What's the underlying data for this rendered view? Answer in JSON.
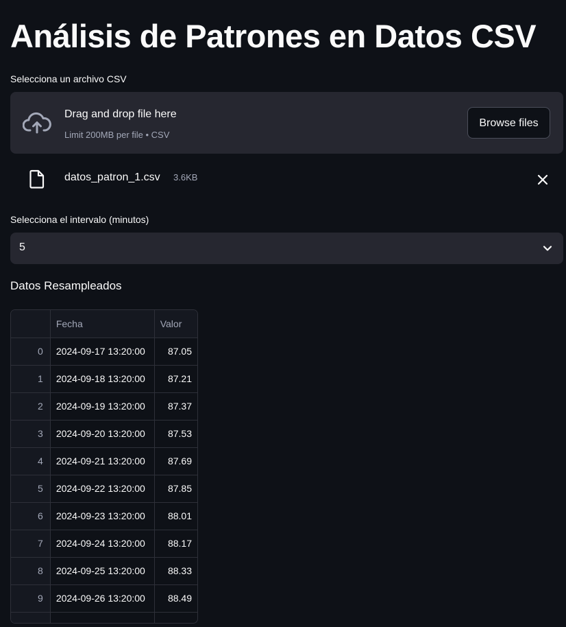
{
  "page": {
    "title": "Análisis de Patrones en Datos CSV"
  },
  "uploader": {
    "label": "Selecciona un archivo CSV",
    "drop_text": "Drag and drop file here",
    "limit_text": "Limit 200MB per file • CSV",
    "browse_label": "Browse files",
    "icon": "cloud-upload-icon"
  },
  "uploaded_file": {
    "name": "datos_patron_1.csv",
    "size": "3.6KB",
    "icon": "file-icon",
    "remove_icon": "close-icon"
  },
  "interval": {
    "label": "Selecciona el intervalo (minutos)",
    "value": "5"
  },
  "resampled": {
    "heading": "Datos Resampleados",
    "columns": [
      "",
      "Fecha",
      "Valor"
    ],
    "rows": [
      {
        "index": "0",
        "fecha": "2024-09-17 13:20:00",
        "valor": "87.05"
      },
      {
        "index": "1",
        "fecha": "2024-09-18 13:20:00",
        "valor": "87.21"
      },
      {
        "index": "2",
        "fecha": "2024-09-19 13:20:00",
        "valor": "87.37"
      },
      {
        "index": "3",
        "fecha": "2024-09-20 13:20:00",
        "valor": "87.53"
      },
      {
        "index": "4",
        "fecha": "2024-09-21 13:20:00",
        "valor": "87.69"
      },
      {
        "index": "5",
        "fecha": "2024-09-22 13:20:00",
        "valor": "87.85"
      },
      {
        "index": "6",
        "fecha": "2024-09-23 13:20:00",
        "valor": "88.01"
      },
      {
        "index": "7",
        "fecha": "2024-09-24 13:20:00",
        "valor": "88.17"
      },
      {
        "index": "8",
        "fecha": "2024-09-25 13:20:00",
        "valor": "88.33"
      },
      {
        "index": "9",
        "fecha": "2024-09-26 13:20:00",
        "valor": "88.49"
      },
      {
        "index": "",
        "fecha": "",
        "valor": ""
      }
    ]
  },
  "colors": {
    "background": "#0e1117",
    "surface": "#262730",
    "text": "#fafafa",
    "muted_text": "#a3a8b8",
    "border": "#2e3039"
  }
}
